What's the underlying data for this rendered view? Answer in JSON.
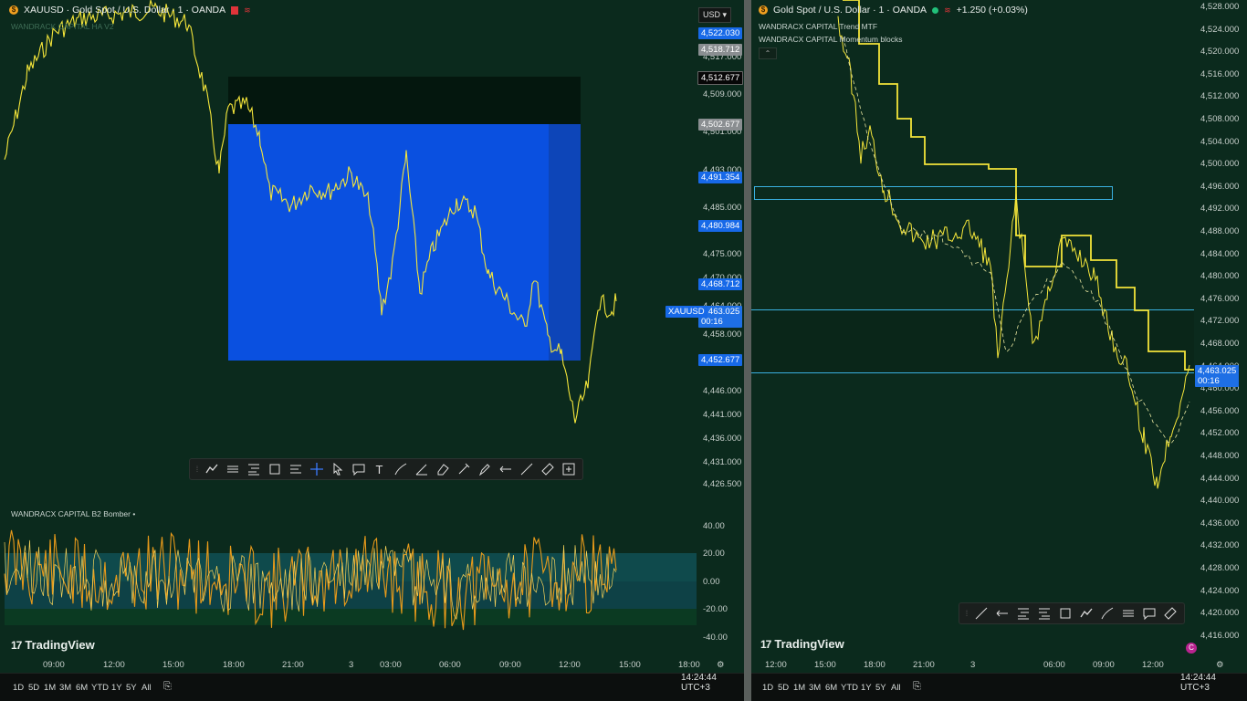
{
  "left": {
    "header": {
      "symbol_icon": "gold-coin-icon",
      "title": "XAUUSD · Gold Spot / U.S. Dollar · 1 · OANDA"
    },
    "currency": "USD",
    "indicator_top": "WANDRACK CAPITAL HA V2",
    "indicator_bottom": "WANDRACX CAPITAL B2 Bomber",
    "prices": [
      "4,517.000",
      "4,509.000",
      "4,501.000",
      "4,493.000",
      "4,485.000",
      "4,475.000",
      "4,470.000",
      "4,464.000",
      "4,458.000",
      "4,446.000",
      "4,441.000",
      "4,436.000",
      "4,431.000",
      "4,426.500"
    ],
    "price_tags": {
      "t1": "4,522.030",
      "t2": "4,518.712",
      "t3": "4,512.677",
      "t4": "4,502.677",
      "t5": "4,491.354",
      "t6": "4,480.984",
      "t7": "4,468.712",
      "t8": "4,463.025",
      "t8_sub": "00:16",
      "t9": "4,452.677"
    },
    "symbol_tag": "XAUUSD",
    "osc_levels": [
      "40.00",
      "20.00",
      "0.00",
      "-20.00",
      "-40.00"
    ],
    "times": [
      "09:00",
      "12:00",
      "15:00",
      "18:00",
      "21:00",
      "3",
      "03:00",
      "06:00",
      "09:00",
      "12:00",
      "15:00",
      "18:00"
    ],
    "timeframes": [
      "1D",
      "5D",
      "1M",
      "3M",
      "6M",
      "YTD",
      "1Y",
      "5Y",
      "All"
    ],
    "clock": "14:24:44 UTC+3",
    "logo": "TradingView"
  },
  "right": {
    "header": {
      "title": "Gold Spot / U.S. Dollar · 1 · OANDA",
      "change": "+1.250 (+0.03%)"
    },
    "indicator_1": "WANDRACX CAPITAL Trend MTF",
    "indicator_2": "WANDRACX CAPITAL Momentum blocks",
    "prices": [
      "4,528.000",
      "4,524.000",
      "4,520.000",
      "4,516.000",
      "4,512.000",
      "4,508.000",
      "4,504.000",
      "4,500.000",
      "4,496.000",
      "4,492.000",
      "4,488.000",
      "4,484.000",
      "4,480.000",
      "4,476.000",
      "4,472.000",
      "4,468.000",
      "4,464.000",
      "4,460.000",
      "4,456.000",
      "4,452.000",
      "4,448.000",
      "4,444.000",
      "4,440.000",
      "4,436.000",
      "4,432.000",
      "4,428.000",
      "4,424.000",
      "4,420.000",
      "4,416.000"
    ],
    "price_tag": "4,463.025",
    "price_tag_sub": "00:16",
    "times": [
      "12:00",
      "15:00",
      "18:00",
      "21:00",
      "3",
      "06:00",
      "09:00",
      "12:00"
    ],
    "timeframes": [
      "1D",
      "5D",
      "1M",
      "3M",
      "6M",
      "YTD",
      "1Y",
      "5Y",
      "All"
    ],
    "clock": "14:24:44 UTC+3",
    "logo": "TradingView"
  },
  "colors": {
    "bg": "#0b2a1d",
    "price_line": "#f5e63a",
    "accent_blue": "#1769e8",
    "osc": "#e89a1a"
  }
}
